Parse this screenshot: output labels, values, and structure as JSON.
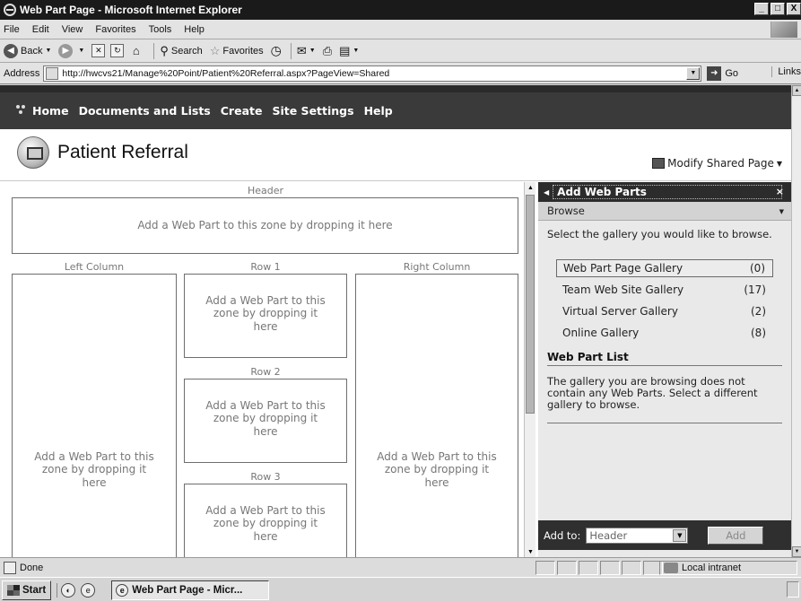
{
  "window": {
    "title": "Web Part Page - Microsoft Internet Explorer",
    "minimize": "_",
    "maximize": "□",
    "close": "X"
  },
  "menu": {
    "file": "File",
    "edit": "Edit",
    "view": "View",
    "favorites": "Favorites",
    "tools": "Tools",
    "help": "Help"
  },
  "toolbar": {
    "back": "Back",
    "search": "Search",
    "favorites": "Favorites"
  },
  "address": {
    "label": "Address",
    "url": "http://hwcvs21/Manage%20Point/Patient%20Referral.aspx?PageView=Shared",
    "go": "Go",
    "links": "Links"
  },
  "sp_nav": {
    "items": [
      "Home",
      "Documents and Lists",
      "Create",
      "Site Settings",
      "Help"
    ]
  },
  "page": {
    "title": "Patient Referral",
    "modify": "Modify Shared Page"
  },
  "zones": {
    "header_label": "Header",
    "header_text": "Add a Web Part to this zone by dropping it here",
    "left_label": "Left Column",
    "row1_label": "Row 1",
    "row2_label": "Row 2",
    "row3_label": "Row 3",
    "right_label": "Right Column",
    "text_line1": "Add a Web Part to this",
    "text_line2": "zone by dropping it",
    "text_line3": "here"
  },
  "panel": {
    "title": "Add Web Parts",
    "close": "×",
    "browse": "Browse",
    "select_text": "Select the gallery you would like to browse.",
    "galleries": [
      {
        "name": "Web Part Page Gallery",
        "count": "(0)"
      },
      {
        "name": "Team Web Site Gallery",
        "count": "(17)"
      },
      {
        "name": "Virtual Server Gallery",
        "count": "(2)"
      },
      {
        "name": "Online Gallery",
        "count": "(8)"
      }
    ],
    "list_heading": "Web Part List",
    "list_text": "The gallery you are browsing does not contain any Web Parts. Select a different gallery to browse.",
    "add_to_label": "Add to:",
    "add_to_value": "Header",
    "add_button": "Add"
  },
  "status": {
    "text": "Done",
    "zone": "Local intranet"
  },
  "taskbar": {
    "start": "Start",
    "task": "Web Part Page - Micr..."
  }
}
